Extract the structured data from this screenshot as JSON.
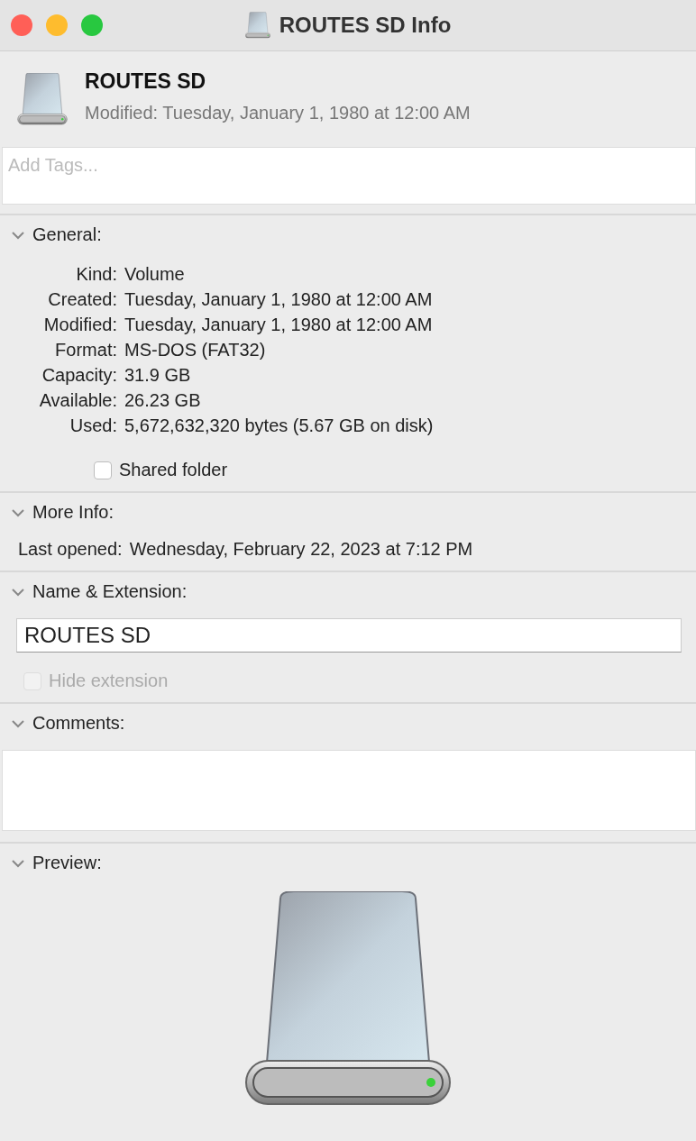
{
  "window": {
    "title": "ROUTES SD Info"
  },
  "header": {
    "name": "ROUTES SD",
    "modified": "Modified: Tuesday, January 1, 1980 at 12:00 AM"
  },
  "tags": {
    "placeholder": "Add Tags..."
  },
  "sections": [
    {
      "kind": "general",
      "title": "General:",
      "expanded": true,
      "rows": [
        {
          "label": "Kind:",
          "value": "Volume"
        },
        {
          "label": "Created:",
          "value": "Tuesday, January 1, 1980 at 12:00 AM"
        },
        {
          "label": "Modified:",
          "value": "Tuesday, January 1, 1980 at 12:00 AM"
        },
        {
          "label": "Format:",
          "value": "MS-DOS (FAT32)"
        },
        {
          "label": "Capacity:",
          "value": "31.9 GB"
        },
        {
          "label": "Available:",
          "value": "26.23 GB"
        },
        {
          "label": "Used:",
          "value": "5,672,632,320 bytes (5.67 GB on disk)"
        }
      ],
      "option": {
        "label": "Shared folder",
        "checked": false,
        "disabled": false
      }
    },
    {
      "kind": "info",
      "title": "More Info:",
      "expanded": true,
      "rows": [
        {
          "label": "Last opened:",
          "value": "Wednesday, February 22, 2023 at 7:12 PM"
        }
      ]
    },
    {
      "kind": "name",
      "title": "Name & Extension:",
      "expanded": true,
      "value": "ROUTES SD",
      "option": {
        "label": "Hide extension",
        "checked": false,
        "disabled": true
      }
    },
    {
      "kind": "comments",
      "title": "Comments:",
      "expanded": true
    },
    {
      "kind": "preview",
      "title": "Preview:",
      "expanded": true
    }
  ]
}
